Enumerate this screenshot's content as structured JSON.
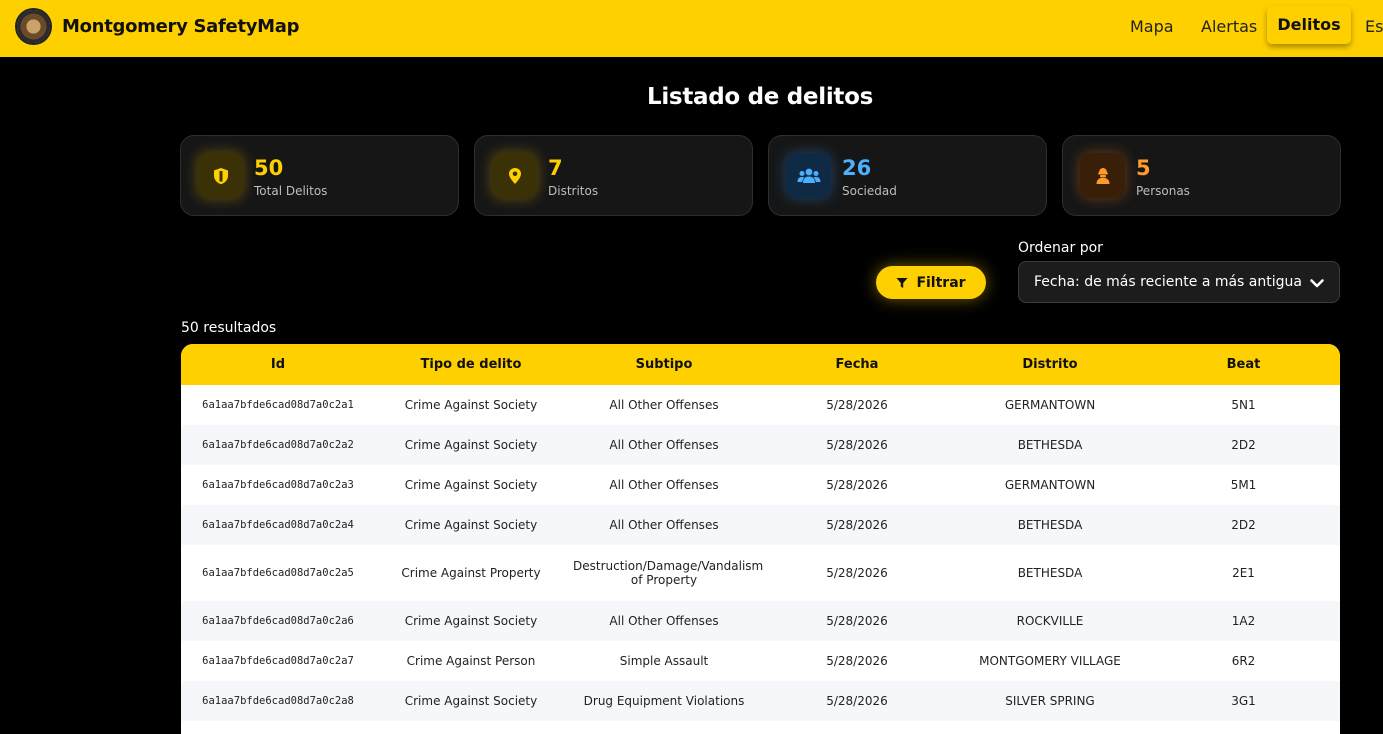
{
  "header": {
    "brand": "Montgomery SafetyMap",
    "nav": {
      "mapa": "Mapa",
      "alertas": "Alertas",
      "delitos": "Delitos",
      "est": "Est"
    }
  },
  "title": "Listado de delitos",
  "stats": {
    "total": {
      "value": "50",
      "label": "Total Delitos",
      "icon": "shield-icon",
      "color": "#ffd000"
    },
    "distritos": {
      "value": "7",
      "label": "Distritos",
      "icon": "map-pin-icon",
      "color": "#ffd000"
    },
    "sociedad": {
      "value": "26",
      "label": "Sociedad",
      "icon": "users-icon",
      "color": "#4ab0ff"
    },
    "personas": {
      "value": "5",
      "label": "Personas",
      "icon": "person-icon",
      "color": "#ff9a2e"
    }
  },
  "controls": {
    "filter_label": "Filtrar",
    "sort_label": "Ordenar por",
    "sort_value": "Fecha: de más reciente a más antigua"
  },
  "results_count": "50 resultados",
  "table": {
    "headers": [
      "Id",
      "Tipo de delito",
      "Subtipo",
      "Fecha",
      "Distrito",
      "Beat"
    ],
    "rows": [
      [
        "6a1aa7bfde6cad08d7a0c2a1",
        "Crime Against Society",
        "All Other Offenses",
        "5/28/2026",
        "GERMANTOWN",
        "5N1"
      ],
      [
        "6a1aa7bfde6cad08d7a0c2a2",
        "Crime Against Society",
        "All Other Offenses",
        "5/28/2026",
        "BETHESDA",
        "2D2"
      ],
      [
        "6a1aa7bfde6cad08d7a0c2a3",
        "Crime Against Society",
        "All Other Offenses",
        "5/28/2026",
        "GERMANTOWN",
        "5M1"
      ],
      [
        "6a1aa7bfde6cad08d7a0c2a4",
        "Crime Against Society",
        "All Other Offenses",
        "5/28/2026",
        "BETHESDA",
        "2D2"
      ],
      [
        "6a1aa7bfde6cad08d7a0c2a5",
        "Crime Against Property",
        "Destruction/Damage/Vandalism of Property",
        "5/28/2026",
        "BETHESDA",
        "2E1"
      ],
      [
        "6a1aa7bfde6cad08d7a0c2a6",
        "Crime Against Society",
        "All Other Offenses",
        "5/28/2026",
        "ROCKVILLE",
        "1A2"
      ],
      [
        "6a1aa7bfde6cad08d7a0c2a7",
        "Crime Against Person",
        "Simple Assault",
        "5/28/2026",
        "MONTGOMERY VILLAGE",
        "6R2"
      ],
      [
        "6a1aa7bfde6cad08d7a0c2a8",
        "Crime Against Society",
        "Drug Equipment Violations",
        "5/28/2026",
        "SILVER SPRING",
        "3G1"
      ]
    ]
  }
}
